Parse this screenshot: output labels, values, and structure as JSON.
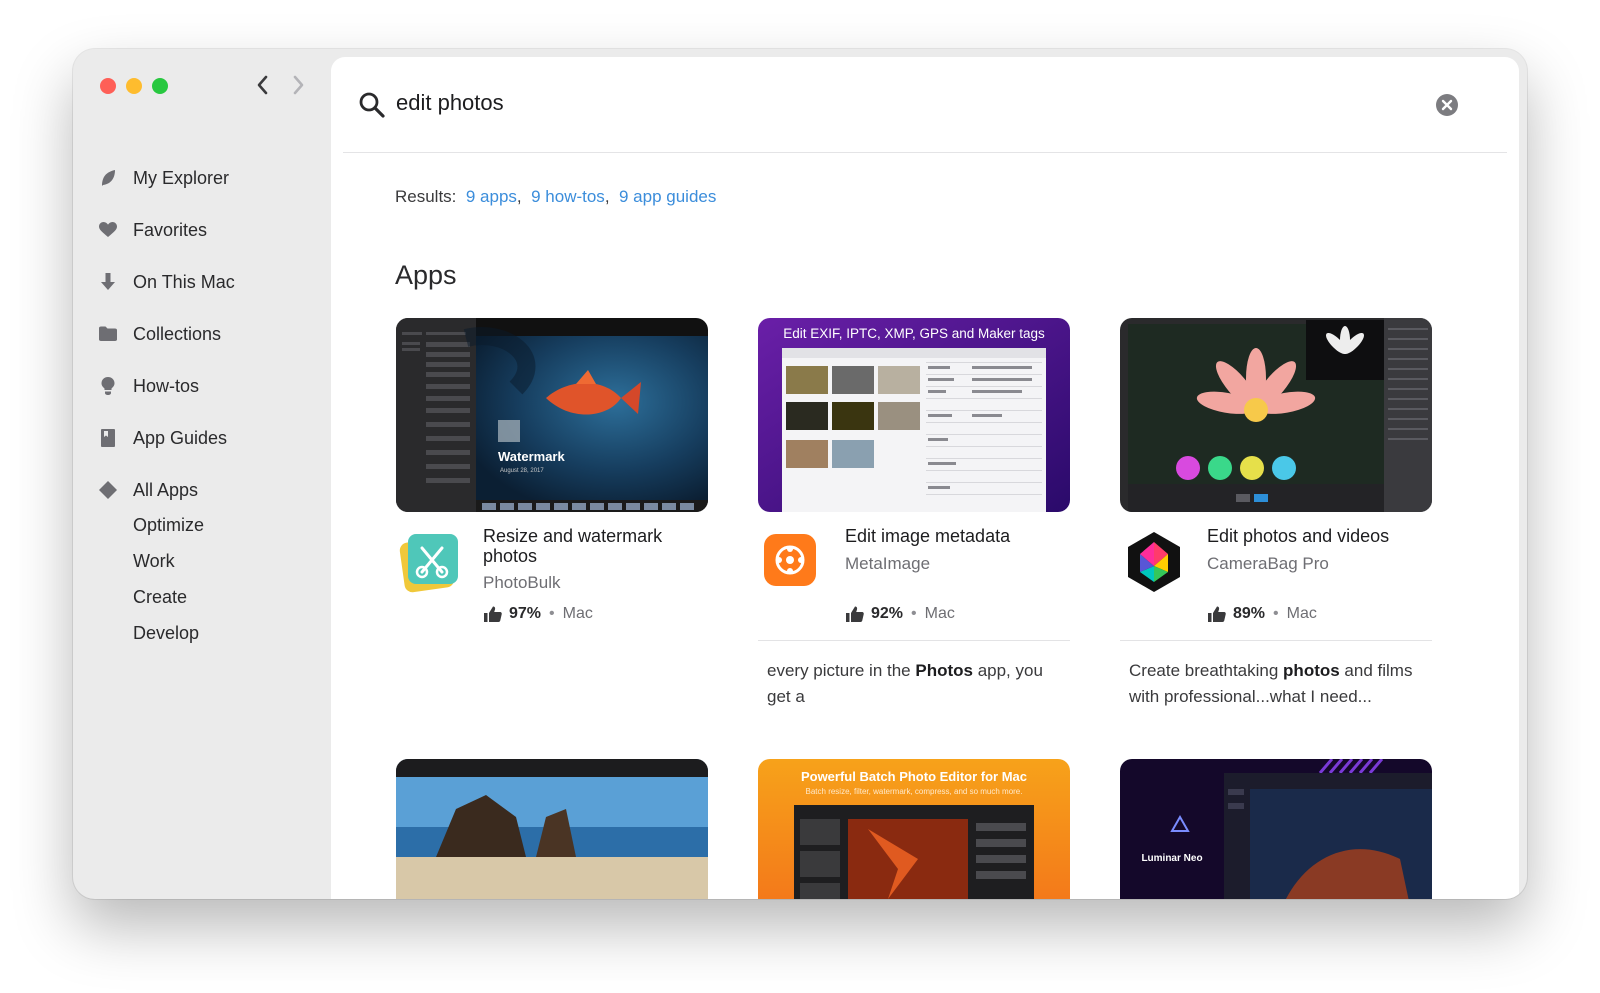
{
  "search": {
    "value": "edit photos",
    "placeholder": ""
  },
  "sidebar": {
    "items": [
      {
        "label": "My Explorer",
        "icon": "leaf-icon"
      },
      {
        "label": "Favorites",
        "icon": "heart-icon"
      },
      {
        "label": "On This Mac",
        "icon": "download-arrow-icon"
      },
      {
        "label": "Collections",
        "icon": "folder-icon"
      },
      {
        "label": "How-tos",
        "icon": "lightbulb-icon"
      },
      {
        "label": "App Guides",
        "icon": "book-icon"
      },
      {
        "label": "All Apps",
        "icon": "diamond-icon"
      }
    ],
    "subitems": [
      "Optimize",
      "Work",
      "Create",
      "Develop"
    ]
  },
  "results": {
    "prefix": "Results:",
    "apps": "9 apps",
    "howtos": "9 how-tos",
    "guides": "9 app guides",
    "sep": ","
  },
  "section_title": "Apps",
  "apps": [
    {
      "title": "Resize and watermark photos",
      "name": "PhotoBulk",
      "rating": "97%",
      "platform": "Mac",
      "thumb_text": "Watermark",
      "thumb_subtext": "August 28, 2017"
    },
    {
      "title": "Edit image metadata",
      "name": "MetaImage",
      "rating": "92%",
      "platform": "Mac",
      "thumb_text": "Edit EXIF, IPTC, XMP, GPS and Maker tags",
      "snippet_pre": "every picture in the ",
      "snippet_bold": "Photos",
      "snippet_post": " app, you get a"
    },
    {
      "title": "Edit photos and videos",
      "name": "CameraBag Pro",
      "rating": "89%",
      "platform": "Mac",
      "snippet_pre": "Create breathtaking ",
      "snippet_bold": "photos",
      "snippet_post": " and films with professional...what I need..."
    }
  ],
  "row2": [
    {
      "thumb_text": ""
    },
    {
      "thumb_text": "Powerful Batch Photo Editor for Mac",
      "thumb_subtext": "Batch resize, filter, watermark, compress, and so much more."
    },
    {
      "thumb_text": "Luminar Neo"
    }
  ],
  "dot": "•",
  "colors": {
    "link": "#3b8ddb",
    "sidebar_bg": "#ebebeb",
    "traffic_red": "#fe5f57",
    "traffic_yellow": "#febc2e",
    "traffic_green": "#28c840"
  }
}
